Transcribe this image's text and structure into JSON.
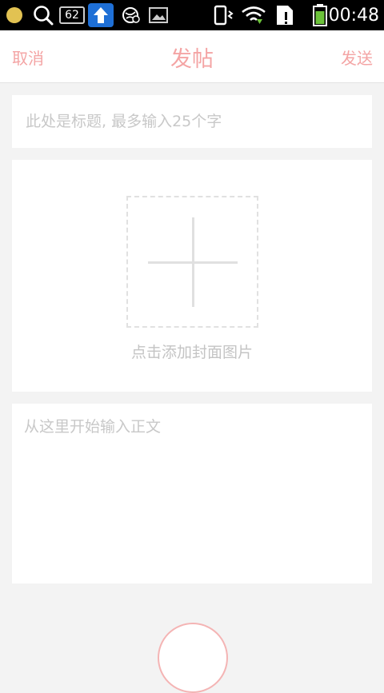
{
  "status_bar": {
    "notification_count": "62",
    "time": "00:48",
    "colors": {
      "background": "#000000",
      "update_badge": "#1e6fd6",
      "battery": "#6cc23a",
      "dot": "#e2c252"
    },
    "icons": [
      "notification-dot-icon",
      "search-icon",
      "message-count-icon",
      "upload-arrow-icon",
      "web-icon",
      "image-icon",
      "vibrate-icon",
      "wifi-icon",
      "sim-alert-icon",
      "battery-icon"
    ]
  },
  "nav": {
    "cancel_label": "取消",
    "title": "发帖",
    "send_label": "发送",
    "accent_color": "#f4a4a4"
  },
  "form": {
    "title_placeholder": "此处是标题, 最多输入25个字",
    "cover_label": "点击添加封面图片",
    "body_placeholder": "从这里开始输入正文",
    "cover_icon": "plus-icon"
  }
}
